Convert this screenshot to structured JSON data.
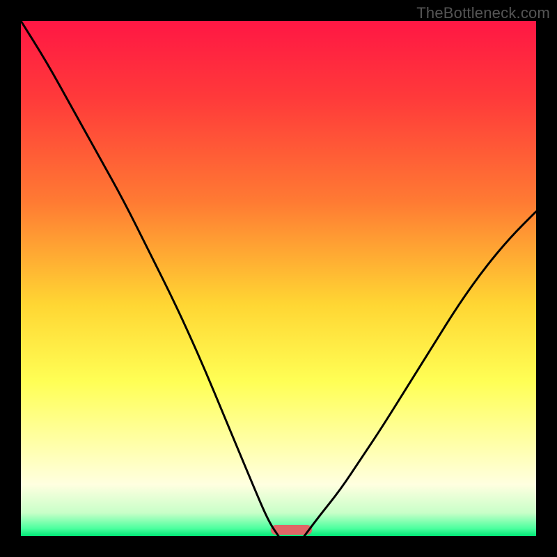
{
  "watermark": "TheBottleneck.com",
  "chart_data": {
    "type": "line",
    "title": "",
    "xlabel": "",
    "ylabel": "",
    "x_range": [
      0,
      100
    ],
    "y_range": [
      0,
      100
    ],
    "gradient_stops": [
      {
        "offset": 0.0,
        "color": "#ff1744"
      },
      {
        "offset": 0.15,
        "color": "#ff3a3a"
      },
      {
        "offset": 0.35,
        "color": "#ff7a33"
      },
      {
        "offset": 0.55,
        "color": "#ffd633"
      },
      {
        "offset": 0.7,
        "color": "#ffff55"
      },
      {
        "offset": 0.82,
        "color": "#ffffa8"
      },
      {
        "offset": 0.9,
        "color": "#ffffe0"
      },
      {
        "offset": 0.955,
        "color": "#c8ffc8"
      },
      {
        "offset": 0.985,
        "color": "#4cff9f"
      },
      {
        "offset": 1.0,
        "color": "#00e676"
      }
    ],
    "series": [
      {
        "name": "left-curve",
        "x": [
          0,
          5,
          10,
          15,
          20,
          25,
          30,
          35,
          40,
          45,
          48,
          50
        ],
        "y": [
          100,
          92,
          83,
          74,
          65,
          55,
          45,
          34,
          22,
          10,
          3,
          0
        ]
      },
      {
        "name": "right-curve",
        "x": [
          55,
          58,
          62,
          66,
          70,
          75,
          80,
          85,
          90,
          95,
          100
        ],
        "y": [
          0,
          4,
          9,
          15,
          21,
          29,
          37,
          45,
          52,
          58,
          63
        ]
      }
    ],
    "marker": {
      "name": "bottleneck-marker",
      "x_center": 52.5,
      "width": 8,
      "color": "#e06666"
    }
  }
}
